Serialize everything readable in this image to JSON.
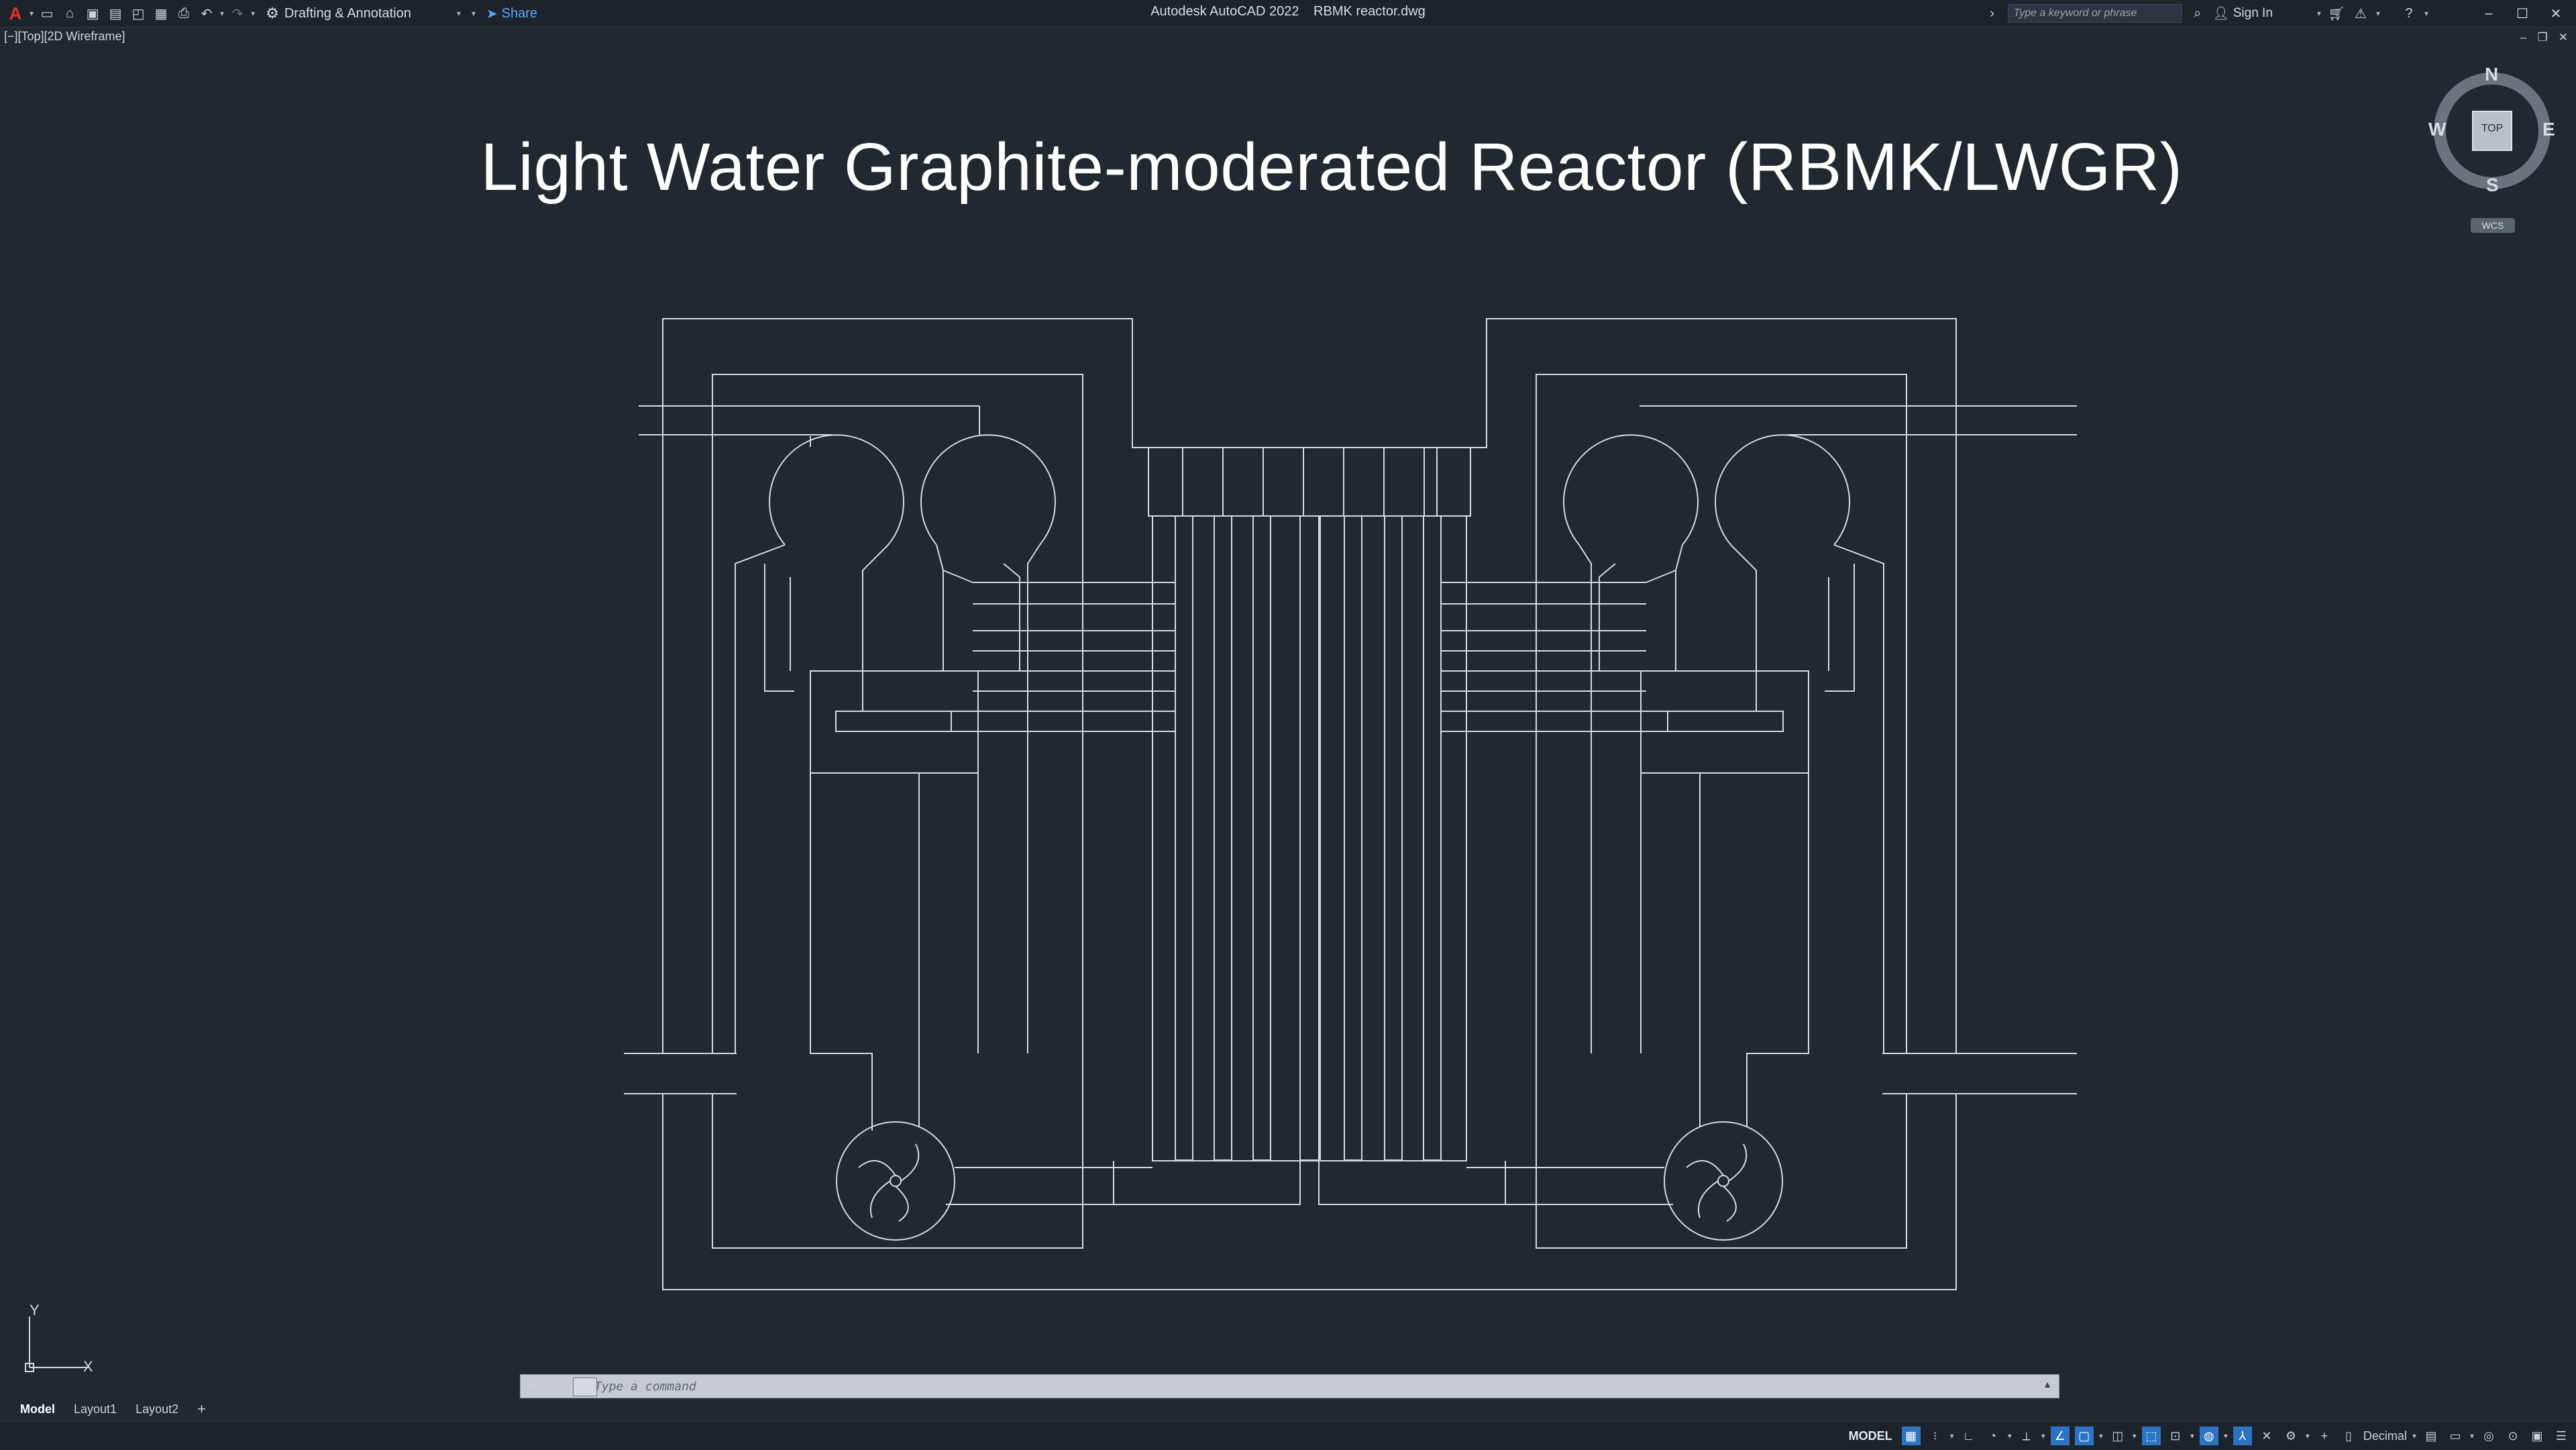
{
  "titlebar": {
    "logo": "A",
    "workspace": "Drafting & Annotation",
    "share": "Share",
    "app_name": "Autodesk AutoCAD 2022",
    "file_name": "RBMK reactor.dwg",
    "search_placeholder": "Type a keyword or phrase",
    "sign_in": "Sign In"
  },
  "viewport": {
    "view_label": "[−][Top][2D Wireframe]",
    "drawing_title": "Light Water Graphite-moderated Reactor (RBMK/LWGR)"
  },
  "viewcube": {
    "face": "TOP",
    "north": "N",
    "south": "S",
    "east": "E",
    "west": "W",
    "wcs": "WCS"
  },
  "ucs": {
    "x": "X",
    "y": "Y"
  },
  "command": {
    "placeholder": "Type a command"
  },
  "tabs": [
    {
      "label": "Model",
      "active": true
    },
    {
      "label": "Layout1",
      "active": false
    },
    {
      "label": "Layout2",
      "active": false
    }
  ],
  "status": {
    "model": "MODEL",
    "units": "Decimal"
  },
  "colors": {
    "background": "#212830",
    "linework": "#d6d9dc",
    "accent": "#2b74c4",
    "logo": "#e03030"
  }
}
